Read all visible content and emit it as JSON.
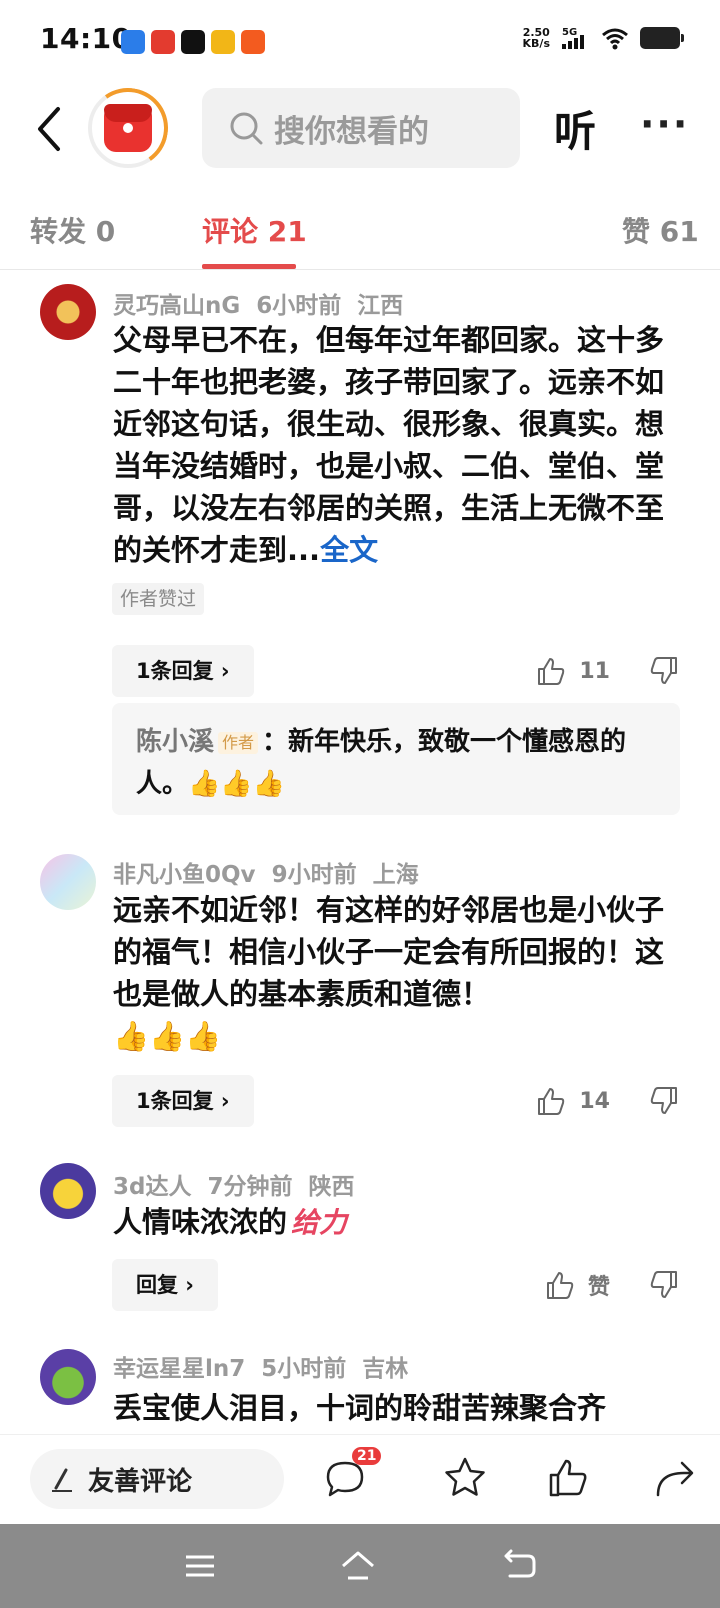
{
  "status": {
    "time": "14:10",
    "net_speed_value": "2.50",
    "net_speed_unit": "KB/s",
    "network": "5G",
    "apps": [
      "app-1",
      "toutiao-icon",
      "tiktok-icon",
      "app-4",
      "taobao-icon"
    ]
  },
  "nav": {
    "search_placeholder": "搜你想看的",
    "listen_label": "听",
    "more_label": "···"
  },
  "tabs": [
    {
      "label": "转发 0"
    },
    {
      "label": "评论 21"
    },
    {
      "label": "赞 61"
    }
  ],
  "comments": [
    {
      "user": "灵巧高山nG",
      "time": "6小时前",
      "location": "江西",
      "text": "父母早已不在，但每年过年都回家。这十多二十年也把老婆，孩子带回家了。远亲不如近邻这句话，很生动、很形象、很真实。想当年没结婚时，也是小叔、二伯、堂伯、堂哥，以没左右邻居的关照，生活上无微不至的关怀才走到...",
      "fulltext_label": "全文",
      "author_liked": "作者赞过",
      "reply_btn": "1条回复 ›",
      "likes": "11",
      "reply": {
        "author": "陈小溪",
        "tag": "作者",
        "text": "：新年快乐，致敬一个懂感恩的人。",
        "emoji": "👍👍👍"
      }
    },
    {
      "user": "非凡小鱼0Qv",
      "time": "9小时前",
      "location": "上海",
      "text": "远亲不如近邻！有这样的好邻居也是小伙子的福气！相信小伙子一定会有所回报的！这也是做人的基本素质和道德！",
      "emoji": "👍👍👍",
      "reply_btn": "1条回复 ›",
      "likes": "14"
    },
    {
      "user": "3d达人",
      "time": "7分钟前",
      "location": "陕西",
      "text": "人情味浓浓的",
      "sticker": "给力",
      "reply_btn": "回复 ›",
      "likes": "赞"
    },
    {
      "user": "幸运星星ln7",
      "time": "5小时前",
      "location": "吉林",
      "text": "丢宝使人泪目，十词的聆甜苦辣聚合齐"
    }
  ],
  "bottom": {
    "input_label": "友善评论",
    "comment_count": "21"
  }
}
